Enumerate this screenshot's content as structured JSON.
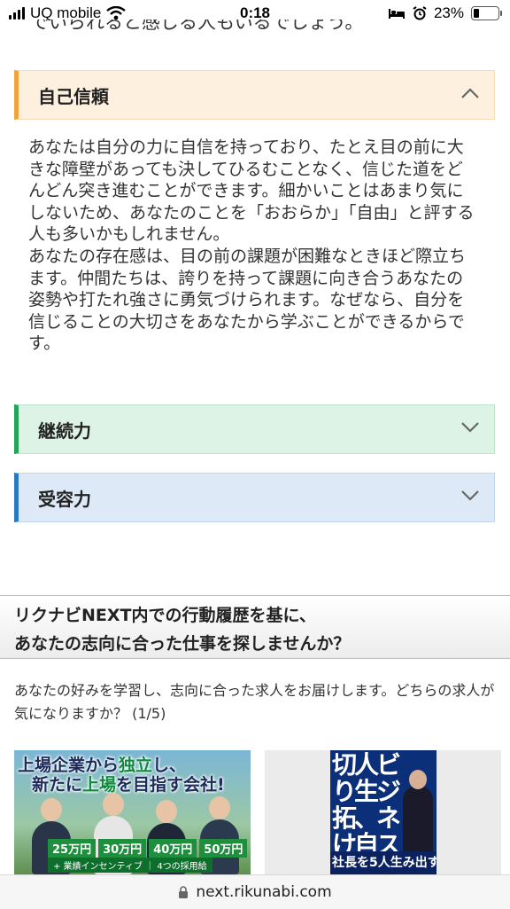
{
  "status_bar": {
    "carrier": "UQ mobile",
    "time": "0:18",
    "battery_percent": "23%",
    "battery_level": 0.23,
    "icons": [
      "signal-icon",
      "wifi-icon",
      "bed-icon",
      "alarm-icon",
      "battery-icon"
    ]
  },
  "cut_off_line": "でいられると感じる人もいるでしょう。",
  "accordion": [
    {
      "label": "自己信頼",
      "expanded": true,
      "accent_color": "#f2a43a",
      "body": [
        "あなたは自分の力に自信を持っており、たとえ目の前に大きな障壁があっても決してひるむことなく、信じた道をどんどん突き進むことができます。細かいことはあまり気にしないため、あなたのことを「おおらか」「自由」と評する人も多いかもしれません。",
        "あなたの存在感は、目の前の課題が困難なときほど際立ちます。仲間たちは、誇りを持って課題に向き合うあなたの姿勢や打たれ強さに勇気づけられます。なぜなら、自分を信じることの大切さをあなたから学ぶことができるからです。"
      ]
    },
    {
      "label": "継続力",
      "expanded": false,
      "accent_color": "#22a45a"
    },
    {
      "label": "受容力",
      "expanded": false,
      "accent_color": "#2a78c2"
    }
  ],
  "recommend": {
    "title_line1": "リクナビNEXT内での行動履歴を基に、",
    "title_line2": "あなたの志向に合った仕事を探しませんか？",
    "description": "あなたの好みを学習し、志向に合った求人をお届けします。どちらの求人が気になりますか？ (1/5)",
    "card1": {
      "line1_a": "上場企業から",
      "line1_b": "独立",
      "line1_c": "し、",
      "line2_a": "新たに",
      "line2_b": "上場",
      "line2_c": "を目指す会社!",
      "salaries": [
        "25万円",
        "30万円",
        "40万円",
        "50万円"
      ],
      "sub": "+ 業績インセンティブ ｜ 4つの採用給"
    },
    "card2": {
      "chars": [
        "切",
        "人",
        "ビ",
        "り",
        "生",
        "ジ",
        "拓",
        "、",
        "ネ",
        "け",
        "自",
        "ス"
      ],
      "strip": "社長を5人生み出す"
    }
  },
  "url_bar": {
    "domain": "next.rikunabi.com"
  }
}
